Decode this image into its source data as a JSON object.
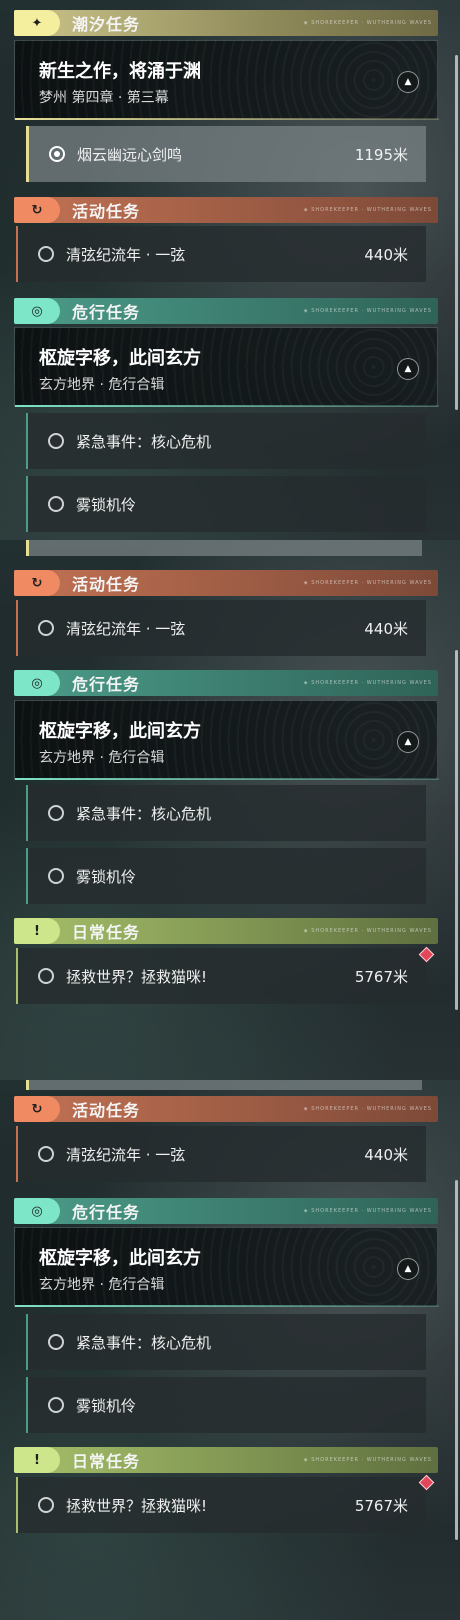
{
  "sections": {
    "tide": {
      "badge_icon": "✦",
      "title": "潮汐任务",
      "deco": "◈ SHOREKEEPER · WUTHERING WAVES"
    },
    "activity": {
      "badge_icon": "↻",
      "title": "活动任务",
      "deco": "◈ SHOREKEEPER · WUTHERING WAVES"
    },
    "risk": {
      "badge_icon": "◎",
      "title": "危行任务",
      "deco": "◈ SHOREKEEPER · WUTHERING WAVES"
    },
    "daily": {
      "badge_icon": "!",
      "title": "日常任务",
      "deco": "◈ SHOREKEEPER · WUTHERING WAVES"
    }
  },
  "tide_card": {
    "title": "新生之作，将涌于渊",
    "subtitle": "梦州 第四章 · 第三幕",
    "toggle": "▲"
  },
  "risk_card": {
    "title": "枢旋字移，此间玄方",
    "subtitle": "玄方地界 · 危行合辑",
    "toggle": "▲"
  },
  "items": {
    "tide_1": {
      "label": "烟云幽远心剑鸣",
      "dist": "1195米"
    },
    "activity_1": {
      "label": "清弦纪流年 · 一弦",
      "dist": "440米"
    },
    "risk_1": {
      "label": "紧急事件：核心危机",
      "dist": ""
    },
    "risk_2": {
      "label": "雾锁机伶",
      "dist": ""
    },
    "daily_1": {
      "label": "拯救世界？拯救猫咪!",
      "dist": "5767米"
    }
  },
  "colors": {
    "tide": "#f4ee9f",
    "activity": "#f08a63",
    "risk": "#7ee6c8",
    "daily": "#cde68b",
    "alert": "#e2485a"
  }
}
